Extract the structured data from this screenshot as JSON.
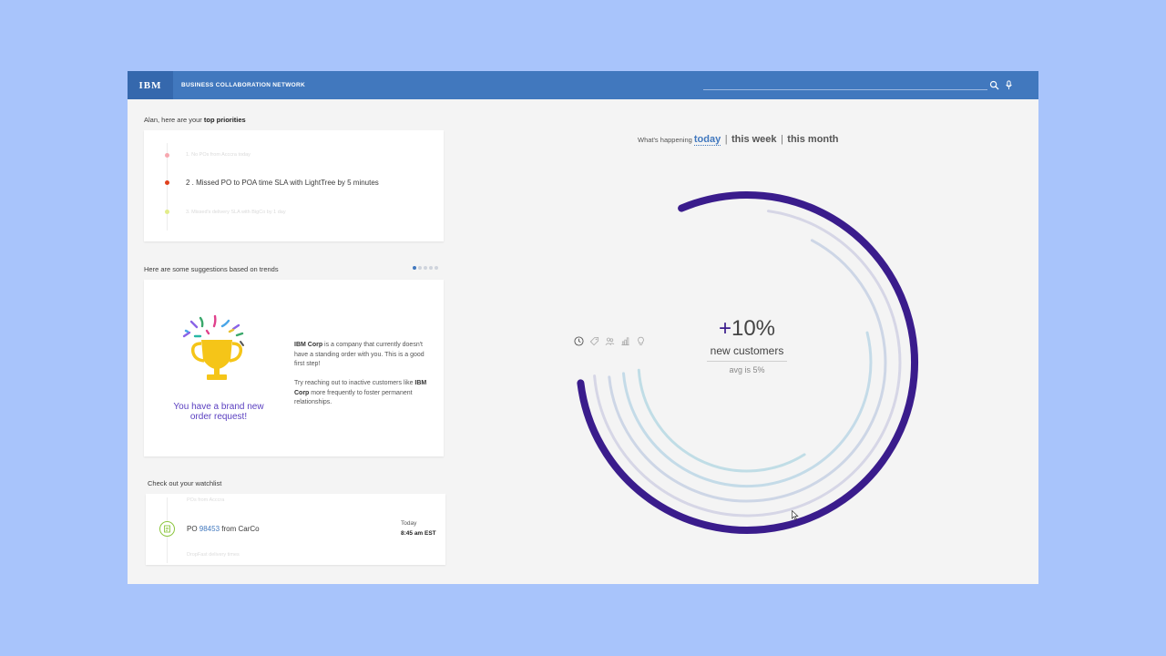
{
  "header": {
    "logo": "IBM",
    "app_title": "BUSINESS COLLABORATION NETWORK",
    "search_value": "",
    "search_icon": "search-icon",
    "mic_icon": "microphone-icon",
    "brand_color": "#4178be"
  },
  "priorities": {
    "greeting": "Alan, here are your ",
    "greeting_bold": "top priorities",
    "items": [
      {
        "text": "1. No POs from Acccra today",
        "color": "#f7a8b0",
        "state": "faded"
      },
      {
        "text": "2 .  Missed PO to POA time SLA with LightTree by 5 minutes",
        "color": "#e0411d",
        "state": "active"
      },
      {
        "text": "3. Missed's delivery SLA with BigCo by 1 day",
        "color": "#e2ec8a",
        "state": "faded"
      }
    ]
  },
  "suggestions": {
    "heading": "Here are some suggestions based on trends",
    "page_count": 5,
    "current_page": 1,
    "trophy_caption": "You have a brand new order request!",
    "paragraph1_company": "IBM Corp",
    "paragraph1_rest": " is a company that currently doesn't have a standing order with you. This is a good first step!",
    "paragraph2_start": "Try reaching out to inactive customers like ",
    "paragraph2_company": "IBM Corp",
    "paragraph2_end": " more frequently to foster permanent relationships."
  },
  "watchlist": {
    "heading": "Check out your watchlist",
    "faded_top": "POs from Acccra",
    "item_prefix": "PO ",
    "po_number": "98453",
    "item_suffix": " from CarCo",
    "day": "Today",
    "time": "8:45 am EST",
    "faded_bottom": "DropFast delivery times",
    "icon": "document-icon"
  },
  "happening": {
    "lead": "What's happening ",
    "options": [
      "today",
      "this week",
      "this month"
    ],
    "selected": "today"
  },
  "metric": {
    "sign": "+",
    "value": "10%",
    "label": "new customers",
    "sub": "avg is 5%"
  },
  "filters": [
    "clock-icon",
    "tag-icon",
    "people-icon",
    "chart-icon",
    "lightbulb-icon"
  ],
  "rings": {
    "main_color": "#3a1c8c",
    "track_colors": [
      "#d6d6e6",
      "#cdd6e6",
      "#c4dbe8",
      "#c0dde6"
    ]
  }
}
